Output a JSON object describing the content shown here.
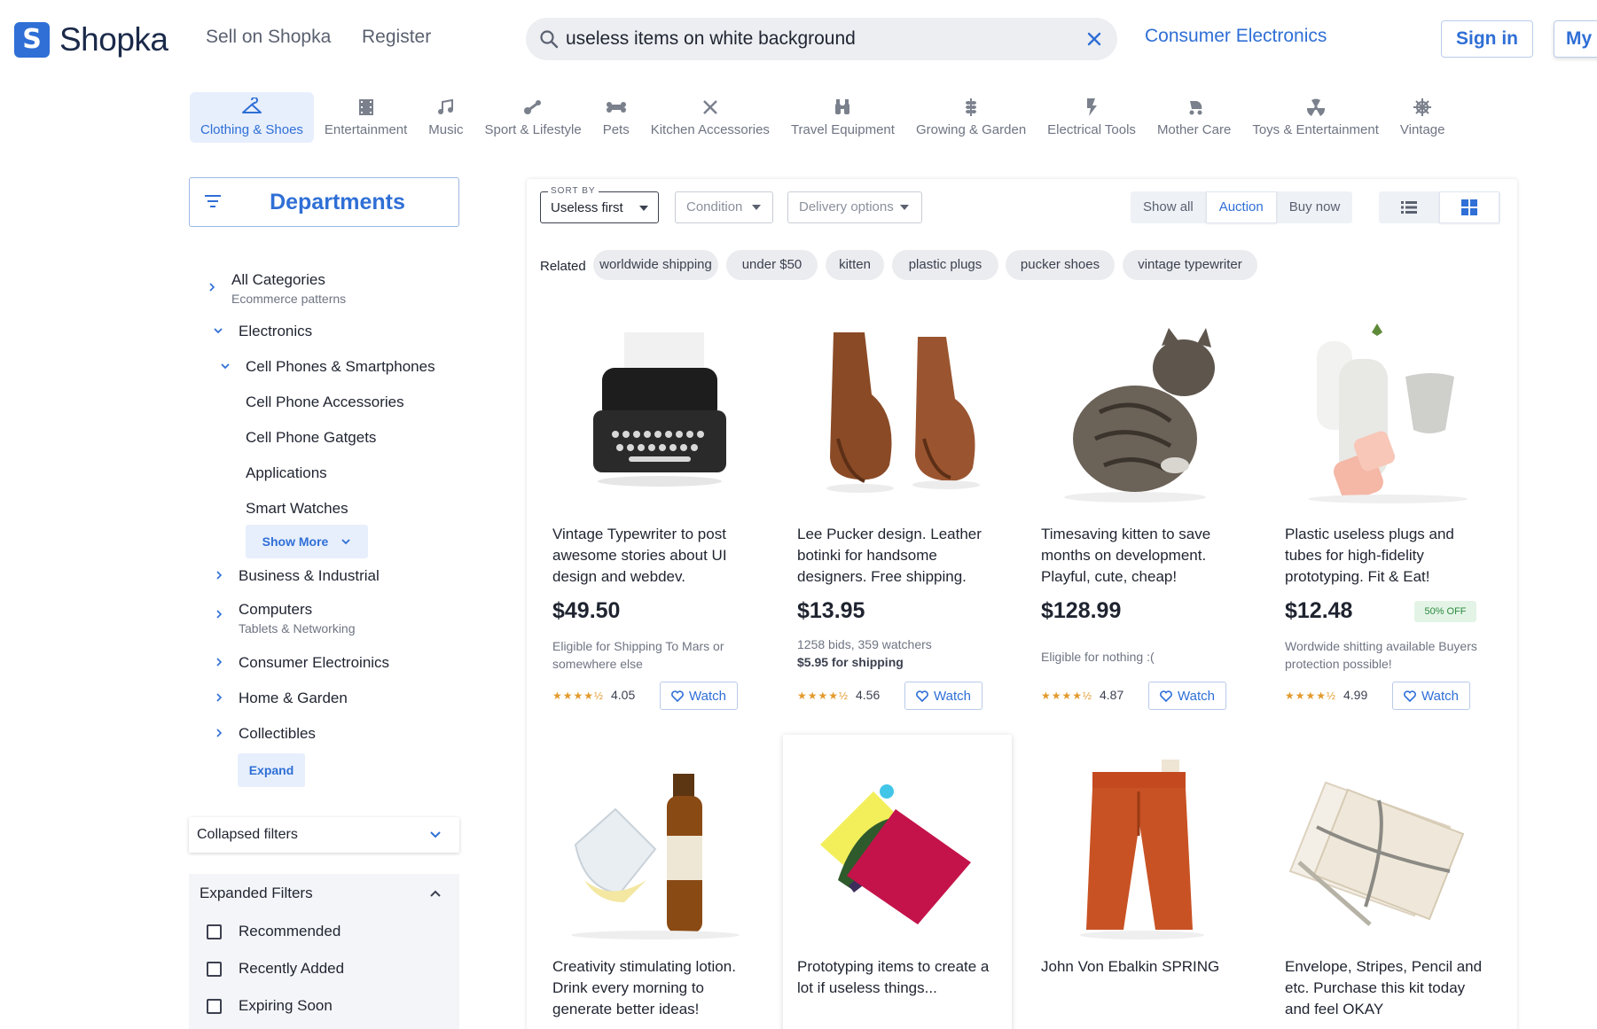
{
  "header": {
    "logo_letter": "S",
    "logo_text": "Shopka",
    "sell_link": "Sell on Shopka",
    "register_link": "Register",
    "search_value": "useless items on white background",
    "category_link": "Consumer Electronics",
    "signin": "Sign in",
    "my_account": "My a"
  },
  "categories": [
    {
      "label": "Clothing & Shoes",
      "icon": "hanger-icon",
      "active": true
    },
    {
      "label": "Entertainment",
      "icon": "film-icon"
    },
    {
      "label": "Music",
      "icon": "music-note-icon"
    },
    {
      "label": "Sport & Lifestyle",
      "icon": "bike-icon"
    },
    {
      "label": "Pets",
      "icon": "bone-icon"
    },
    {
      "label": "Kitchen Accessories",
      "icon": "utensils-icon"
    },
    {
      "label": "Travel Equipment",
      "icon": "binoculars-icon"
    },
    {
      "label": "Growing & Garden",
      "icon": "wheat-icon"
    },
    {
      "label": "Electrical Tools",
      "icon": "bolt-icon"
    },
    {
      "label": "Mother Care",
      "icon": "stroller-icon"
    },
    {
      "label": "Toys & Entertainment",
      "icon": "radiation-icon"
    },
    {
      "label": "Vintage",
      "icon": "ship-wheel-icon"
    }
  ],
  "sidebar": {
    "departments": "Departments",
    "all_categories": "All Categories",
    "all_categories_sub": "Ecommerce patterns",
    "electronics": "Electronics",
    "cell_phones": "Cell Phones & Smartphones",
    "sub_items": [
      "Cell Phone Accessories",
      "Cell Phone Gatgets",
      "Applications",
      "Smart Watches"
    ],
    "show_more": "Show More",
    "business": "Business & Industrial",
    "computers": "Computers",
    "computers_sub": "Tablets & Networking",
    "consumer": "Consumer Electroinics",
    "home": "Home & Garden",
    "collectibles": "Collectibles",
    "expand": "Expand",
    "collapsed_filters": "Collapsed filters",
    "expanded_filters": "Expanded Filters",
    "filters": [
      "Recommended",
      "Recently Added",
      "Expiring Soon"
    ]
  },
  "toolbar": {
    "sort_label": "SORT BY",
    "sort_value": "Useless first",
    "condition": "Condition",
    "delivery": "Delivery options",
    "segments": [
      "Show all",
      "Auction",
      "Buy now"
    ],
    "segment_active": "Auction"
  },
  "related": {
    "label": "Related",
    "chips": [
      "worldwide shipping",
      "under $50",
      "kitten",
      "plastic plugs",
      "pucker shoes",
      "vintage typewriter"
    ]
  },
  "products": [
    {
      "title": "Vintage Typewriter to post awesome stories about UI design and webdev.",
      "price": "$49.50",
      "info": "Eligible for Shipping To Mars or somewhere else",
      "rating": "4.05",
      "watch": "Watch",
      "stars": "★★★★½"
    },
    {
      "title": "Lee Pucker design. Leather botinki for handsome designers. Free shipping.",
      "price": "$13.95",
      "info": "1258 bids, 359 watchers",
      "info_bold": "$5.95 for shipping",
      "rating": "4.56",
      "watch": "Watch",
      "stars": "★★★★½"
    },
    {
      "title": "Timesaving kitten to save months on development. Playful, cute, cheap!",
      "price": "$128.99",
      "info": "Eligible for nothing :(",
      "rating": "4.87",
      "watch": "Watch",
      "stars": "★★★★½"
    },
    {
      "title": "Plastic useless plugs and tubes for high-fidelity prototyping. Fit & Eat!",
      "price": "$12.48",
      "badge": "50% OFF",
      "info": "Wordwide shitting available Buyers protection possible!",
      "rating": "4.99",
      "watch": "Watch",
      "stars": "★★★★½"
    },
    {
      "title": "Creativity stimulating lotion. Drink every morning to generate better ideas!"
    },
    {
      "title": "Prototyping items to create a lot if useless things..."
    },
    {
      "title": "John Von Ebalkin SPRING"
    },
    {
      "title": "Envelope, Stripes, Pencil and etc. Purchase this kit today and feel OKAY"
    }
  ],
  "colors": {
    "accent": "#2f6fd6",
    "star": "#e39a2c",
    "badge_bg": "#e3f4e6",
    "badge_fg": "#2c8a3f"
  }
}
